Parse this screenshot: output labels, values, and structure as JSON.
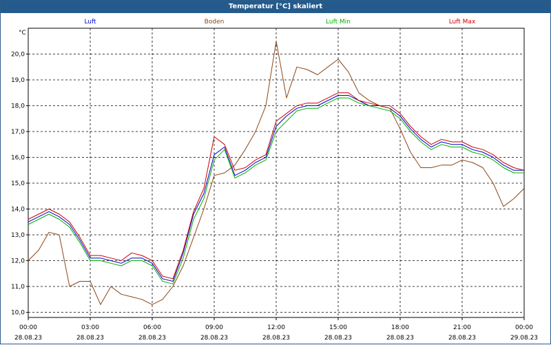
{
  "chart_data": {
    "type": "line",
    "title": "Temperatur [°C] skaliert",
    "ylabel": "°C",
    "ylim": [
      9.8,
      21.0
    ],
    "xlim": [
      0,
      24
    ],
    "y_ticks": [
      "10,0",
      "11,0",
      "12,0",
      "13,0",
      "14,0",
      "15,0",
      "16,0",
      "17,0",
      "18,0",
      "19,0",
      "20,0"
    ],
    "x_ticks": [
      {
        "time": "00:00",
        "date": "28.08.23"
      },
      {
        "time": "03:00",
        "date": "28.08.23"
      },
      {
        "time": "06:00",
        "date": "28.08.23"
      },
      {
        "time": "09:00",
        "date": "28.08.23"
      },
      {
        "time": "12:00",
        "date": "28.08.23"
      },
      {
        "time": "15:00",
        "date": "28.08.23"
      },
      {
        "time": "18:00",
        "date": "28.08.23"
      },
      {
        "time": "21:00",
        "date": "28.08.23"
      },
      {
        "time": "00:00",
        "date": "29.08.23"
      }
    ],
    "grid": true,
    "legend_position": "top",
    "series": [
      {
        "name": "Luft",
        "color": "#0000cc",
        "x": [
          0,
          0.5,
          1,
          1.5,
          2,
          2.5,
          3,
          3.5,
          4,
          4.5,
          5,
          5.5,
          6,
          6.5,
          7,
          7.5,
          8,
          8.5,
          9,
          9.5,
          10,
          10.5,
          11,
          11.5,
          12,
          12.5,
          13,
          13.5,
          14,
          14.5,
          15,
          15.5,
          16,
          16.5,
          17,
          17.5,
          18,
          18.5,
          19,
          19.5,
          20,
          20.5,
          21,
          21.5,
          22,
          22.5,
          23,
          23.5,
          24
        ],
        "y": [
          13.5,
          13.7,
          13.9,
          13.7,
          13.4,
          12.8,
          12.1,
          12.1,
          12.0,
          11.9,
          12.1,
          12.1,
          11.9,
          11.3,
          11.2,
          12.3,
          13.8,
          14.6,
          16.1,
          16.4,
          15.3,
          15.5,
          15.8,
          16.0,
          17.2,
          17.6,
          17.9,
          18.0,
          18.0,
          18.2,
          18.4,
          18.4,
          18.2,
          18.0,
          18.0,
          17.9,
          17.6,
          17.1,
          16.7,
          16.4,
          16.6,
          16.5,
          16.5,
          16.3,
          16.2,
          16.0,
          15.7,
          15.5,
          15.5
        ]
      },
      {
        "name": "Boden",
        "color": "#8b4513",
        "x": [
          0,
          0.5,
          1,
          1.5,
          2,
          2.5,
          3,
          3.5,
          4,
          4.5,
          5,
          5.5,
          6,
          6.5,
          7,
          7.5,
          8,
          8.5,
          9,
          9.5,
          10,
          10.5,
          11,
          11.5,
          12,
          12.5,
          13,
          13.5,
          14,
          14.5,
          15,
          15.5,
          16,
          16.5,
          17,
          17.5,
          18,
          18.5,
          19,
          19.5,
          20,
          20.5,
          21,
          21.5,
          22,
          22.5,
          23,
          23.5,
          24
        ],
        "y": [
          12.0,
          12.4,
          13.1,
          13.0,
          11.0,
          11.2,
          11.2,
          10.3,
          11.0,
          10.7,
          10.6,
          10.5,
          10.3,
          10.5,
          11.0,
          11.8,
          12.9,
          14.0,
          15.3,
          15.4,
          15.7,
          16.3,
          17.0,
          18.0,
          20.5,
          18.3,
          19.5,
          19.4,
          19.2,
          19.5,
          19.8,
          19.3,
          18.5,
          18.2,
          18.0,
          17.9,
          17.1,
          16.2,
          15.6,
          15.6,
          15.7,
          15.7,
          15.9,
          15.8,
          15.6,
          15.0,
          14.1,
          14.4,
          14.8
        ]
      },
      {
        "name": "Luft Min",
        "color": "#00b000",
        "x": [
          0,
          0.5,
          1,
          1.5,
          2,
          2.5,
          3,
          3.5,
          4,
          4.5,
          5,
          5.5,
          6,
          6.5,
          7,
          7.5,
          8,
          8.5,
          9,
          9.5,
          10,
          10.5,
          11,
          11.5,
          12,
          12.5,
          13,
          13.5,
          14,
          14.5,
          15,
          15.5,
          16,
          16.5,
          17,
          17.5,
          18,
          18.5,
          19,
          19.5,
          20,
          20.5,
          21,
          21.5,
          22,
          22.5,
          23,
          23.5,
          24
        ],
        "y": [
          13.4,
          13.6,
          13.8,
          13.6,
          13.3,
          12.7,
          12.0,
          12.0,
          11.9,
          11.8,
          12.0,
          12.0,
          11.8,
          11.2,
          11.1,
          12.1,
          13.6,
          14.4,
          15.9,
          16.3,
          15.2,
          15.4,
          15.7,
          15.9,
          17.0,
          17.4,
          17.8,
          17.9,
          17.9,
          18.1,
          18.3,
          18.3,
          18.1,
          18.0,
          17.9,
          17.8,
          17.5,
          17.0,
          16.6,
          16.3,
          16.5,
          16.4,
          16.4,
          16.2,
          16.1,
          15.9,
          15.6,
          15.4,
          15.4
        ]
      },
      {
        "name": "Luft Max",
        "color": "#cc0000",
        "x": [
          0,
          0.5,
          1,
          1.5,
          2,
          2.5,
          3,
          3.5,
          4,
          4.5,
          5,
          5.5,
          6,
          6.5,
          7,
          7.5,
          8,
          8.5,
          9,
          9.5,
          10,
          10.5,
          11,
          11.5,
          12,
          12.5,
          13,
          13.5,
          14,
          14.5,
          15,
          15.5,
          16,
          16.5,
          17,
          17.5,
          18,
          18.5,
          19,
          19.5,
          20,
          20.5,
          21,
          21.5,
          22,
          22.5,
          23,
          23.5,
          24
        ],
        "y": [
          13.6,
          13.8,
          14.0,
          13.8,
          13.5,
          12.9,
          12.2,
          12.2,
          12.1,
          12.0,
          12.3,
          12.2,
          12.0,
          11.4,
          11.3,
          12.4,
          13.9,
          14.8,
          16.8,
          16.5,
          15.5,
          15.6,
          15.9,
          16.1,
          17.4,
          17.7,
          18.0,
          18.1,
          18.1,
          18.3,
          18.5,
          18.5,
          18.2,
          18.1,
          18.0,
          18.0,
          17.7,
          17.2,
          16.8,
          16.5,
          16.7,
          16.6,
          16.6,
          16.4,
          16.3,
          16.1,
          15.8,
          15.6,
          15.5
        ]
      }
    ]
  }
}
